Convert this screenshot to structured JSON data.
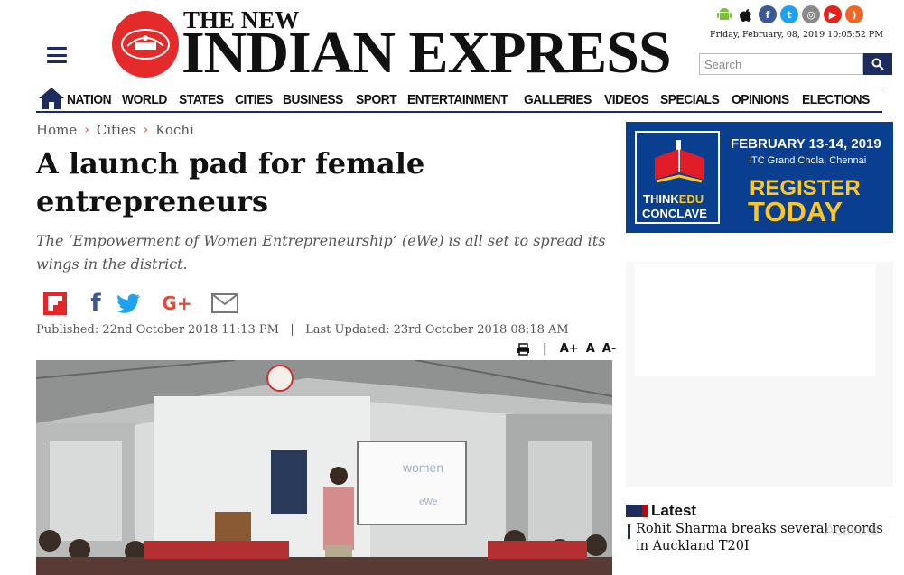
{
  "header": {
    "brand_small": "THE NEW",
    "brand_big": "INDIAN EXPRESS",
    "date": "Friday, February, 08, 2019 10:05:52 PM",
    "app_icons": [
      "android-icon",
      "apple-icon",
      "facebook-icon",
      "twitter-icon",
      "instagram-icon",
      "youtube-icon",
      "rss-icon"
    ],
    "search": {
      "placeholder": "Search",
      "value": ""
    }
  },
  "nav": {
    "items": [
      "NATION",
      "WORLD",
      "STATES",
      "CITIES",
      "BUSINESS",
      "SPORT",
      "ENTERTAINMENT",
      "GALLERIES",
      "VIDEOS",
      "SPECIALS",
      "OPINIONS",
      "ELECTIONS"
    ]
  },
  "breadcrumb": [
    "Home",
    "Cities",
    "Kochi"
  ],
  "article": {
    "title": "A launch pad for female entrepreneurs",
    "subtitle": "The ‘Empowerment of Women Entrepreneurship’ (eWe) is all set to spread its wings in the district.",
    "published": "Published: 22nd October 2018 11:13 PM",
    "updated": "Last Updated: 23rd October 2018 08:18 AM",
    "divider": "|",
    "font_tools": [
      "A+",
      "A",
      "A-"
    ],
    "share": [
      "flipboard-icon",
      "facebook-icon",
      "twitter-icon",
      "google-plus-icon",
      "email-icon"
    ],
    "image_caption_text": "women",
    "image_caption_text2": "eWe"
  },
  "ad": {
    "logo_line1": "THINK",
    "logo_line1b": "EDU",
    "logo_line2": "CONCLAVE",
    "date": "FEBRUARY 13-14, 2019",
    "venue": "ITC Grand Chola, Chennai",
    "register": "REGISTER",
    "today": "TODAY"
  },
  "latest": {
    "heading": "Latest",
    "items": [
      "Rohit Sharma breaks several records in Auckland T20I"
    ]
  },
  "watermark": "Activate",
  "colors": {
    "brand_red": "#e42b2b",
    "navy": "#1d2c5e",
    "ad_blue": "#0a3f8f",
    "ad_yellow": "#ffc81e"
  }
}
